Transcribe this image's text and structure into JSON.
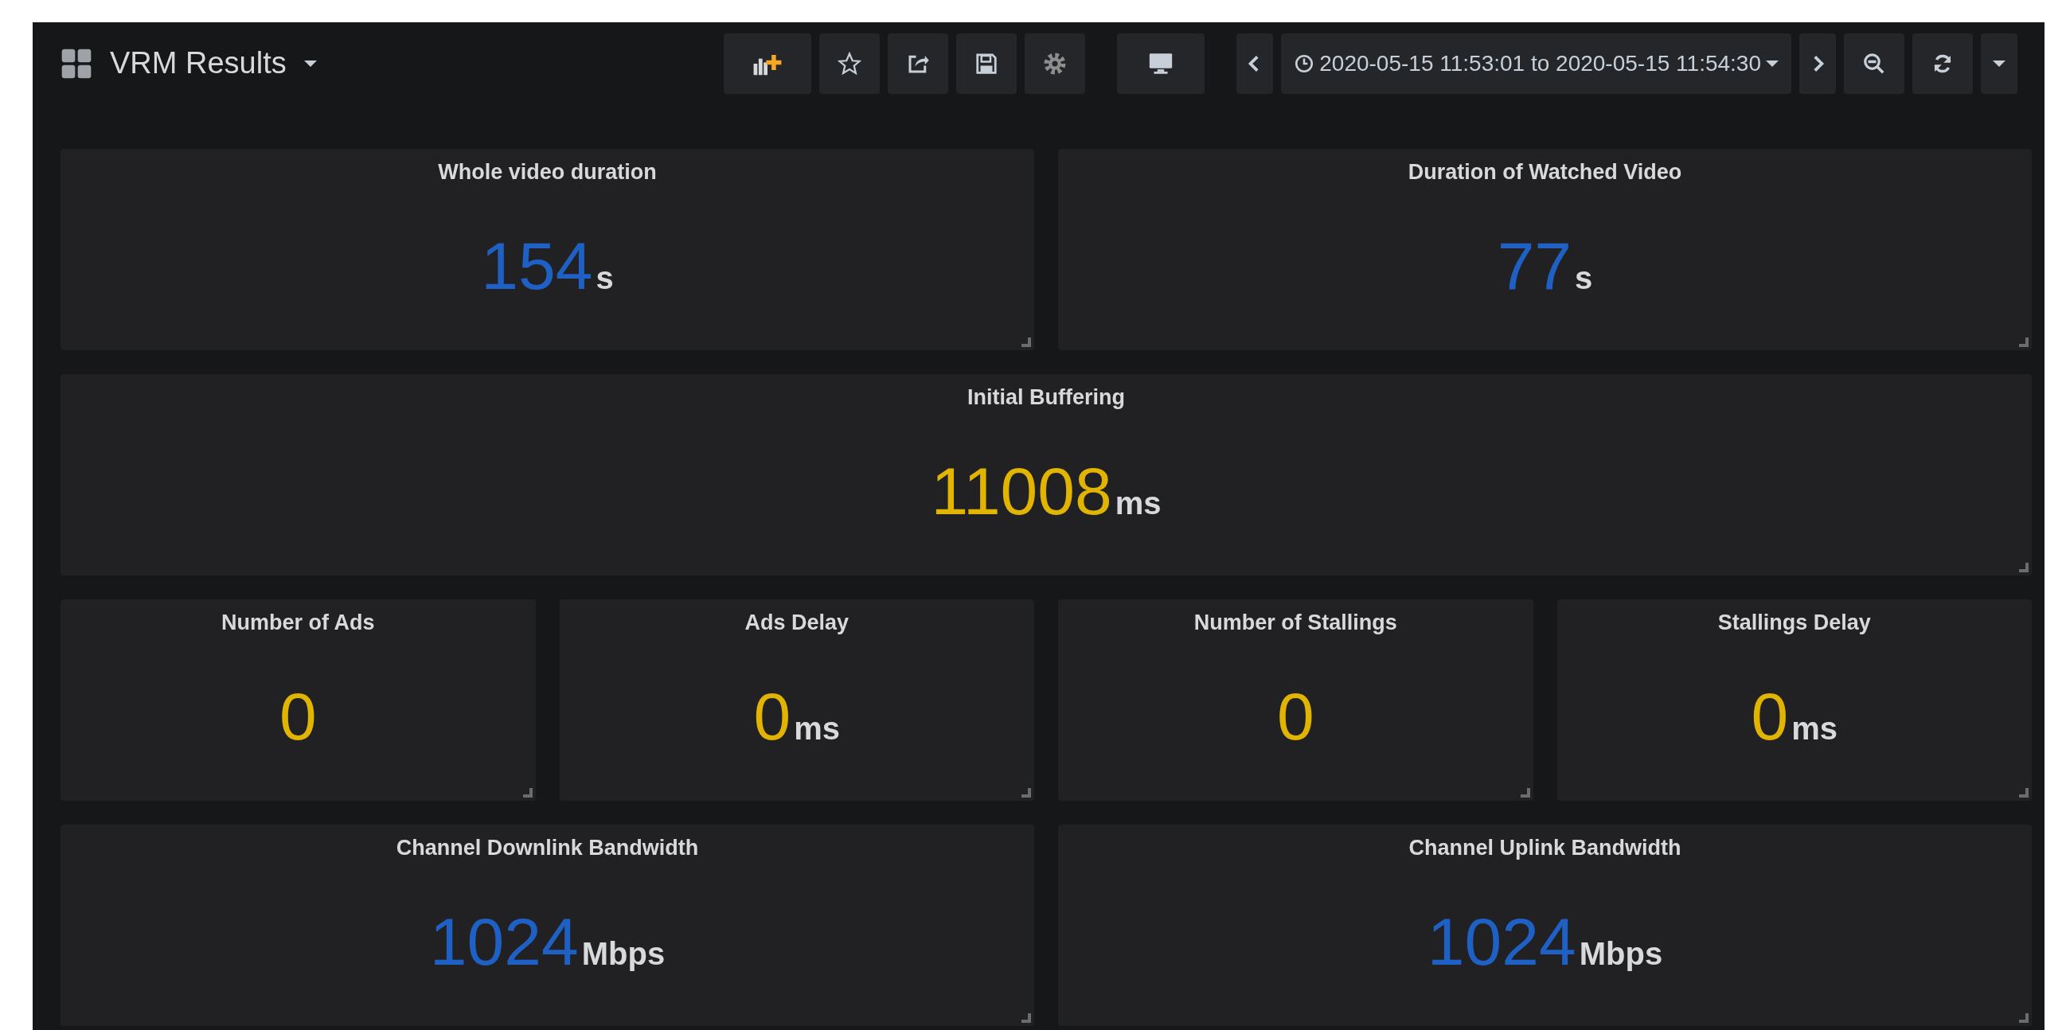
{
  "toolbar": {
    "dashboard_title": "VRM Results",
    "time_range": "2020-05-15 11:53:01 to 2020-05-15 11:54:30"
  },
  "rows": [
    [
      {
        "title": "Whole video duration",
        "value": "154",
        "unit": "s",
        "color": "#1f60c4"
      },
      {
        "title": "Duration of Watched Video",
        "value": "77",
        "unit": "s",
        "color": "#1f60c4"
      }
    ],
    [
      {
        "title": "Initial Buffering",
        "value": "11008",
        "unit": "ms",
        "color": "#e0b400"
      }
    ],
    [
      {
        "title": "Number of Ads",
        "value": "0",
        "color": "#e0b400"
      },
      {
        "title": "Ads Delay",
        "value": "0",
        "unit": "ms",
        "color": "#e0b400"
      },
      {
        "title": "Number of Stallings",
        "value": "0",
        "color": "#e0b400"
      },
      {
        "title": "Stallings Delay",
        "value": "0",
        "unit": "ms",
        "color": "#e0b400"
      }
    ],
    [
      {
        "title": "Channel Downlink Bandwidth",
        "value": "1024",
        "unit": "Mbps",
        "color": "#1f60c4"
      },
      {
        "title": "Channel Uplink Bandwidth",
        "value": "1024",
        "unit": "Mbps",
        "color": "#1f60c4"
      }
    ]
  ]
}
